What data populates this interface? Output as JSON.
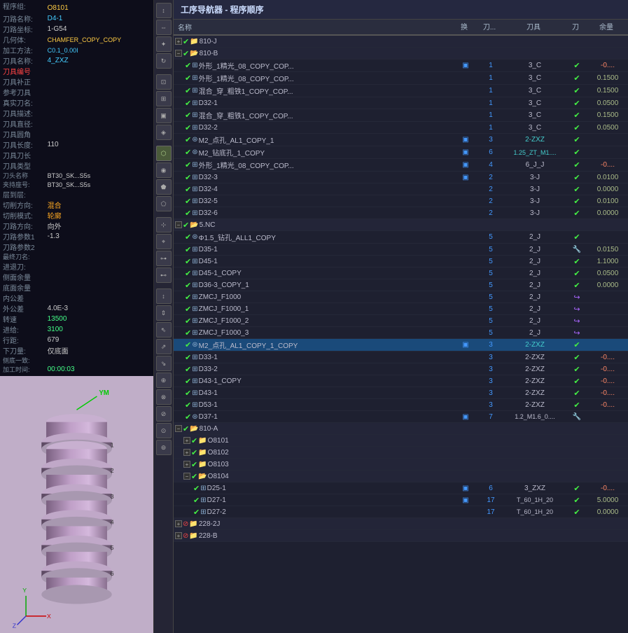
{
  "app": {
    "title": "工序导航器 - 程序顺序"
  },
  "left_panel": {
    "info_rows": [
      {
        "label": "程序组:",
        "value": "O8101",
        "style": "highlight"
      },
      {
        "label": "刀路名称:",
        "value": "D4-1",
        "style": "cyan"
      },
      {
        "label": "刀路坐标:",
        "value": "1-G54",
        "style": "normal"
      },
      {
        "label": "几何体:",
        "value": "CHAMFER_COPY_COPY",
        "style": "highlight"
      },
      {
        "label": "加工方法:",
        "value": "C0.1_0.001",
        "style": "cyan"
      },
      {
        "label": "刀具名称:",
        "value": "4_ZXZ",
        "style": "cyan"
      },
      {
        "label": "刀具编号",
        "value": "",
        "style": "red"
      },
      {
        "label": "刀具补正",
        "value": "",
        "style": "normal"
      },
      {
        "label": "参考刀具",
        "value": "",
        "style": "normal"
      },
      {
        "label": "真实刀名:",
        "value": "",
        "style": "normal"
      },
      {
        "label": "刀具描述:",
        "value": "",
        "style": "normal"
      },
      {
        "label": "刀具直径:",
        "value": "",
        "style": "normal"
      },
      {
        "label": "刀具圆角",
        "value": "",
        "style": "normal"
      },
      {
        "label": "刀具长度:",
        "value": "110",
        "style": "normal"
      },
      {
        "label": "刀具刀长",
        "value": "",
        "style": "normal"
      },
      {
        "label": "刀具类型",
        "value": "",
        "style": "normal"
      },
      {
        "label": "刀头名称",
        "value": "BT30_SK...",
        "style": "normal"
      },
      {
        "label": "夹持座号:",
        "value": "BT30_SK...",
        "style": "normal"
      },
      {
        "label": "层到层:",
        "value": "",
        "style": "normal"
      },
      {
        "label": "切削方向:",
        "value": "混合",
        "style": "orange"
      },
      {
        "label": "切削模式:",
        "value": "轮廓",
        "style": "orange"
      },
      {
        "label": "刀路方向:",
        "value": "向外",
        "style": "normal"
      },
      {
        "label": "刀路参数1",
        "value": "-1.3",
        "style": "normal"
      },
      {
        "label": "刀路参数2",
        "value": "",
        "style": "normal"
      },
      {
        "label": "最终刀名:",
        "value": "",
        "style": "normal"
      },
      {
        "label": "进退刀:",
        "value": "",
        "style": "normal"
      },
      {
        "label": "侧面余量",
        "value": "",
        "style": "normal"
      },
      {
        "label": "底面余量",
        "value": "",
        "style": "normal"
      },
      {
        "label": "内公差",
        "value": "",
        "style": "normal"
      },
      {
        "label": "外公差",
        "value": "4.0E-3",
        "style": "normal"
      },
      {
        "label": "转速",
        "value": "13500",
        "style": "green"
      },
      {
        "label": "进给:",
        "value": "3100",
        "style": "green"
      },
      {
        "label": "行距:",
        "value": "679",
        "style": "normal"
      },
      {
        "label": "下刀量:",
        "value": "仅底面",
        "style": "normal"
      },
      {
        "label": "侧底一致:",
        "value": "",
        "style": "normal"
      },
      {
        "label": "加工时间:",
        "value": "00:00:03",
        "style": "green"
      }
    ]
  },
  "toolbar": {
    "nav_label": "工序导航器 - 程序顺序"
  },
  "table": {
    "headers": [
      "名称",
      "换",
      "刀...",
      "刀具",
      "刀",
      "余量"
    ],
    "rows": [
      {
        "level": 1,
        "expand": true,
        "status": "check",
        "status2": "folder",
        "name": "810-J",
        "huan": "",
        "dao": "",
        "tool": "",
        "dv": "",
        "remain": ""
      },
      {
        "level": 1,
        "expand": true,
        "status": "check",
        "status2": "folder",
        "name": "810-B",
        "huan": "",
        "dao": "",
        "tool": "",
        "dv": "",
        "remain": "",
        "expanded": true
      },
      {
        "level": 2,
        "expand": false,
        "status": "check",
        "status2": "file",
        "name": "外形_1精光_08_COPY_COP...",
        "huan": "1",
        "dao": "1",
        "tool": "3_C",
        "dv": "check",
        "remain": "-0...."
      },
      {
        "level": 2,
        "expand": false,
        "status": "check",
        "status2": "file",
        "name": "外形_1精光_08_COPY_COP...",
        "huan": "",
        "dao": "1",
        "tool": "3_C",
        "dv": "check",
        "remain": "0.1500"
      },
      {
        "level": 2,
        "expand": false,
        "status": "check",
        "status2": "file",
        "name": "混合_穿_粗铁1_COPY_COP...",
        "huan": "",
        "dao": "1",
        "tool": "3_C",
        "dv": "check",
        "remain": "0.1500"
      },
      {
        "level": 2,
        "expand": false,
        "status": "check",
        "status2": "file",
        "name": "D32-1",
        "huan": "",
        "dao": "1",
        "tool": "3_C",
        "dv": "check",
        "remain": "0.0500"
      },
      {
        "level": 2,
        "expand": false,
        "status": "check",
        "status2": "file",
        "name": "混合_穿_粗铁1_COPY_COP...",
        "huan": "",
        "dao": "1",
        "tool": "3_C",
        "dv": "check",
        "remain": "0.1500"
      },
      {
        "level": 2,
        "expand": false,
        "status": "check",
        "status2": "file",
        "name": "D32-2",
        "huan": "",
        "dao": "1",
        "tool": "3_C",
        "dv": "check",
        "remain": "0.0500"
      },
      {
        "level": 2,
        "expand": false,
        "status": "check",
        "status2": "drill",
        "name": "M2_点孔_AL1_COPY_1",
        "huan": "blue",
        "dao": "3",
        "tool": "2-ZXZ",
        "dv": "check",
        "remain": ""
      },
      {
        "level": 2,
        "expand": false,
        "status": "check",
        "status2": "drill",
        "name": "M2_钻底孔_1_COPY",
        "huan": "blue",
        "dao": "6",
        "tool": "1.25_ZT_M1....",
        "dv": "check",
        "remain": ""
      },
      {
        "level": 2,
        "expand": false,
        "status": "check",
        "status2": "file",
        "name": "外形_1精光_08_COPY_COP...",
        "huan": "blue",
        "dao": "4",
        "tool": "6_J_J",
        "dv": "check",
        "remain": "-0...."
      },
      {
        "level": 2,
        "expand": false,
        "status": "check",
        "status2": "file",
        "name": "D32-3",
        "huan": "blue",
        "dao": "2",
        "tool": "3-J",
        "dv": "check",
        "remain": "0.0100"
      },
      {
        "level": 2,
        "expand": false,
        "status": "check",
        "status2": "file",
        "name": "D32-4",
        "huan": "",
        "dao": "2",
        "tool": "3-J",
        "dv": "check",
        "remain": "0.0000"
      },
      {
        "level": 2,
        "expand": false,
        "status": "check",
        "status2": "file",
        "name": "D32-5",
        "huan": "",
        "dao": "2",
        "tool": "3-J",
        "dv": "check",
        "remain": "0.0100"
      },
      {
        "level": 2,
        "expand": false,
        "status": "check",
        "status2": "file",
        "name": "D32-6",
        "huan": "",
        "dao": "2",
        "tool": "3-J",
        "dv": "check",
        "remain": "0.0000"
      },
      {
        "level": 1,
        "expand": true,
        "status": "check",
        "status2": "folder",
        "name": "5.NC",
        "huan": "",
        "dao": "",
        "tool": "",
        "dv": "",
        "remain": "",
        "expanded": true
      },
      {
        "level": 2,
        "expand": false,
        "status": "check",
        "status2": "drill",
        "name": "Φ1.5_钻孔_ALL1_COPY",
        "huan": "",
        "dao": "5",
        "tool": "2_J",
        "dv": "check",
        "remain": ""
      },
      {
        "level": 2,
        "expand": false,
        "status": "check",
        "status2": "file",
        "name": "D35-1",
        "huan": "",
        "dao": "5",
        "tool": "2_J",
        "dv": "wrench",
        "remain": "0.0150"
      },
      {
        "level": 2,
        "expand": false,
        "status": "check",
        "status2": "file",
        "name": "D45-1",
        "huan": "",
        "dao": "5",
        "tool": "2_J",
        "dv": "check",
        "remain": "1.1000"
      },
      {
        "level": 2,
        "expand": false,
        "status": "check",
        "status2": "file",
        "name": "D45-1_COPY",
        "huan": "",
        "dao": "5",
        "tool": "2_J",
        "dv": "check",
        "remain": "0.0500"
      },
      {
        "level": 2,
        "expand": false,
        "status": "check",
        "status2": "file",
        "name": "D36-3_COPY_1",
        "huan": "",
        "dao": "5",
        "tool": "2_J",
        "dv": "check",
        "remain": "0.0000"
      },
      {
        "level": 2,
        "expand": false,
        "status": "check",
        "status2": "file",
        "name": "ZMCJ_F1000",
        "huan": "",
        "dao": "5",
        "tool": "2_J",
        "dv": "arrow",
        "remain": ""
      },
      {
        "level": 2,
        "expand": false,
        "status": "check",
        "status2": "file",
        "name": "ZMCJ_F1000_1",
        "huan": "",
        "dao": "5",
        "tool": "2_J",
        "dv": "arrow",
        "remain": ""
      },
      {
        "level": 2,
        "expand": false,
        "status": "check",
        "status2": "file",
        "name": "ZMCJ_F1000_2",
        "huan": "",
        "dao": "5",
        "tool": "2_J",
        "dv": "arrow",
        "remain": ""
      },
      {
        "level": 2,
        "expand": false,
        "status": "check",
        "status2": "file",
        "name": "ZMCJ_F1000_3",
        "huan": "",
        "dao": "5",
        "tool": "2_J",
        "dv": "arrow",
        "remain": ""
      },
      {
        "level": 2,
        "expand": false,
        "status": "check",
        "status2": "drill",
        "name": "M2_点孔_AL1_COPY_1_COPY",
        "huan": "blue",
        "dao": "3",
        "tool": "2-ZXZ",
        "dv": "check",
        "remain": "",
        "selected": true
      },
      {
        "level": 2,
        "expand": false,
        "status": "check",
        "status2": "file",
        "name": "D33-1",
        "huan": "",
        "dao": "3",
        "tool": "2-ZXZ",
        "dv": "check",
        "remain": "-0...."
      },
      {
        "level": 2,
        "expand": false,
        "status": "check",
        "status2": "file",
        "name": "D33-2",
        "huan": "",
        "dao": "3",
        "tool": "2-ZXZ",
        "dv": "check",
        "remain": "-0...."
      },
      {
        "level": 2,
        "expand": false,
        "status": "check",
        "status2": "file",
        "name": "D43-1_COPY",
        "huan": "",
        "dao": "3",
        "tool": "2-ZXZ",
        "dv": "check",
        "remain": "-0...."
      },
      {
        "level": 2,
        "expand": false,
        "status": "check",
        "status2": "file",
        "name": "D43-1",
        "huan": "",
        "dao": "3",
        "tool": "2-ZXZ",
        "dv": "check",
        "remain": "-0...."
      },
      {
        "level": 2,
        "expand": false,
        "status": "check",
        "status2": "file",
        "name": "D53-1",
        "huan": "",
        "dao": "3",
        "tool": "2-ZXZ",
        "dv": "check",
        "remain": "-0...."
      },
      {
        "level": 2,
        "expand": false,
        "status": "check",
        "status2": "drill",
        "name": "D37-1",
        "huan": "blue",
        "dao": "7",
        "tool": "1.2_M1.6_0....",
        "dv": "wrench",
        "remain": ""
      },
      {
        "level": 1,
        "expand": true,
        "status": "check",
        "status2": "folder",
        "name": "810-A",
        "huan": "",
        "dao": "",
        "tool": "",
        "dv": "",
        "remain": ""
      },
      {
        "level": 2,
        "expand": true,
        "status": "check",
        "status2": "folder",
        "name": "O8101",
        "huan": "",
        "dao": "",
        "tool": "",
        "dv": "",
        "remain": ""
      },
      {
        "level": 2,
        "expand": true,
        "status": "check",
        "status2": "folder",
        "name": "O8102",
        "huan": "",
        "dao": "",
        "tool": "",
        "dv": "",
        "remain": ""
      },
      {
        "level": 2,
        "expand": true,
        "status": "check",
        "status2": "folder",
        "name": "O8103",
        "huan": "",
        "dao": "",
        "tool": "",
        "dv": "",
        "remain": ""
      },
      {
        "level": 2,
        "expand": true,
        "status": "check",
        "status2": "folder",
        "name": "O8104",
        "huan": "",
        "dao": "",
        "tool": "",
        "dv": "",
        "remain": "",
        "expanded": true
      },
      {
        "level": 3,
        "expand": false,
        "status": "check",
        "status2": "file",
        "name": "D25-1",
        "huan": "blue",
        "dao": "6",
        "tool": "3_ZXZ",
        "dv": "check",
        "remain": "-0...."
      },
      {
        "level": 3,
        "expand": false,
        "status": "check",
        "status2": "file",
        "name": "D27-1",
        "huan": "blue",
        "dao": "17",
        "tool": "T_60_1H_20",
        "dv": "check",
        "remain": "5.0000"
      },
      {
        "level": 3,
        "expand": false,
        "status": "check",
        "status2": "file",
        "name": "D27-2",
        "huan": "",
        "dao": "17",
        "tool": "T_60_1H_20",
        "dv": "check",
        "remain": "0.0000"
      },
      {
        "level": 1,
        "expand": true,
        "status": "stop",
        "status2": "folder",
        "name": "228-2J",
        "huan": "",
        "dao": "",
        "tool": "",
        "dv": "",
        "remain": ""
      },
      {
        "level": 1,
        "expand": true,
        "status": "stop",
        "status2": "folder",
        "name": "228-B",
        "huan": "",
        "dao": "",
        "tool": "",
        "dv": "",
        "remain": ""
      }
    ]
  }
}
